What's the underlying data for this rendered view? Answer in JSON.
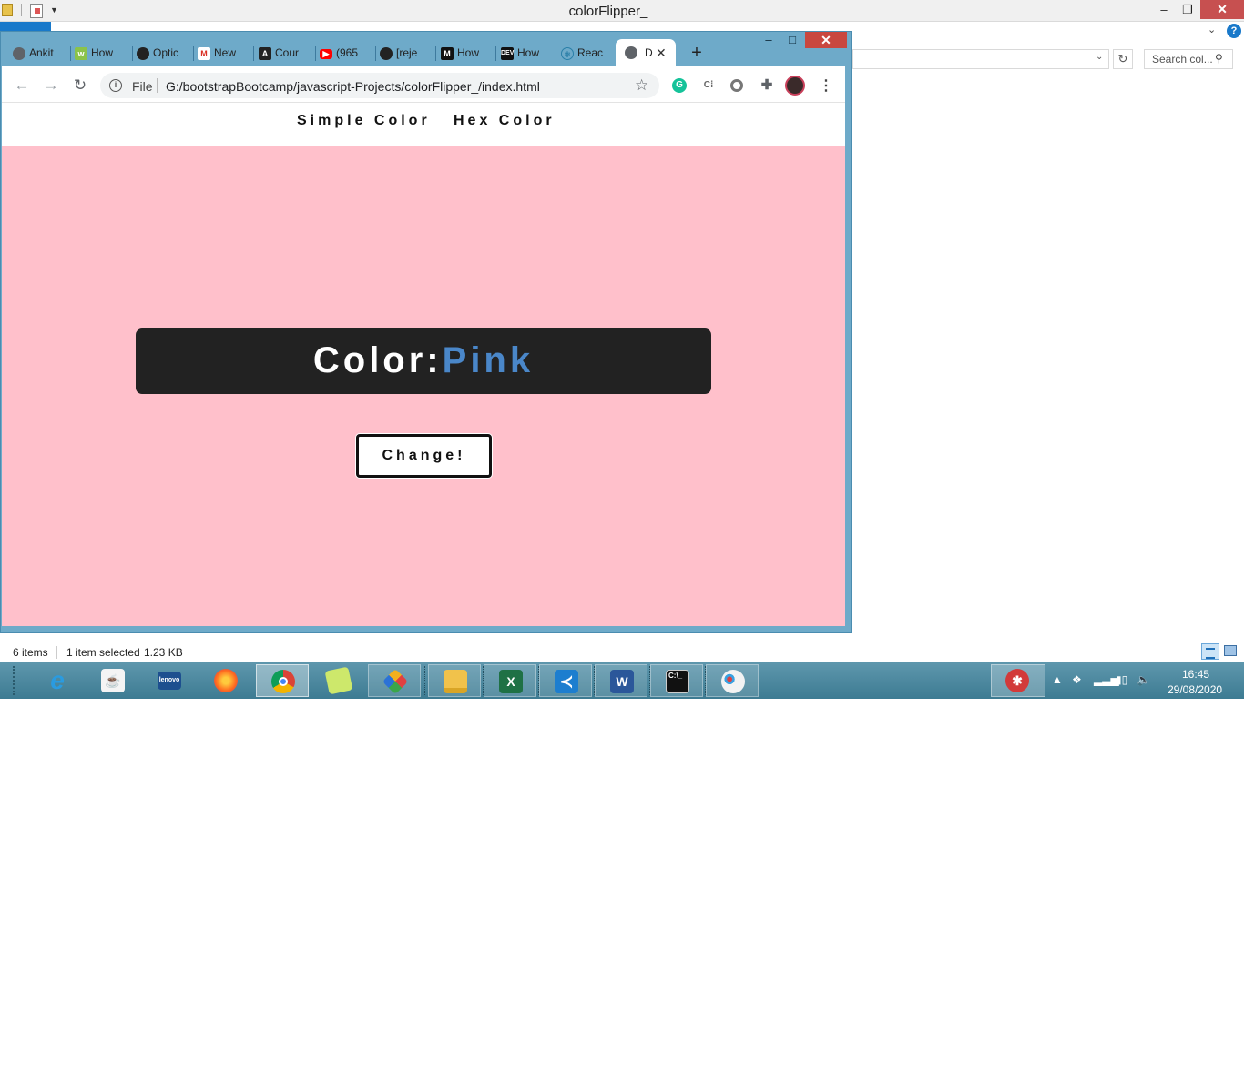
{
  "explorer": {
    "title": "colorFlipper_",
    "search_placeholder": "Search col...",
    "status": {
      "items": "6 items",
      "selected": "1 item selected",
      "size": "1.23 KB"
    }
  },
  "chrome": {
    "tabs": [
      {
        "label": "Ankit",
        "icon": "globe-icon",
        "color": "#5f6368"
      },
      {
        "label": "How",
        "icon": "w3schools-icon",
        "color": "#8bc34a"
      },
      {
        "label": "Optic",
        "icon": "github-icon",
        "color": "#222222"
      },
      {
        "label": "New",
        "icon": "gmail-icon",
        "color": "#d93025"
      },
      {
        "label": "Cour",
        "icon": "angular-icon",
        "color": "#222222"
      },
      {
        "label": "(965",
        "icon": "youtube-icon",
        "color": "#ff0000"
      },
      {
        "label": "[reje",
        "icon": "github-icon",
        "color": "#222222"
      },
      {
        "label": "How",
        "icon": "medium-icon",
        "color": "#111111"
      },
      {
        "label": "How",
        "icon": "dev-icon",
        "color": "#111111"
      },
      {
        "label": "Reac",
        "icon": "react-icon",
        "color": "#2a7fa8"
      }
    ],
    "active_tab": {
      "label": "D",
      "icon": "globe-icon"
    },
    "omnibox": {
      "scheme_label": "File",
      "url": "G:/bootstrapBootcamp/javascript-Projects/colorFlipper_/index.html"
    }
  },
  "page": {
    "nav": {
      "simple": "Simple Color",
      "hex": "Hex Color"
    },
    "banner": {
      "label": "Color:",
      "value": "Pink"
    },
    "button_label": "Change!",
    "background_color": "#ffc0cb"
  },
  "taskbar": {
    "apps": [
      "internet-explorer",
      "java",
      "lenovo",
      "firefox",
      "chrome",
      "sticky-notes",
      "snipping-tool",
      "file-explorer",
      "excel",
      "vscode",
      "word",
      "cmd",
      "paint"
    ],
    "clock": {
      "time": "16:45",
      "date": "29/08/2020"
    }
  }
}
